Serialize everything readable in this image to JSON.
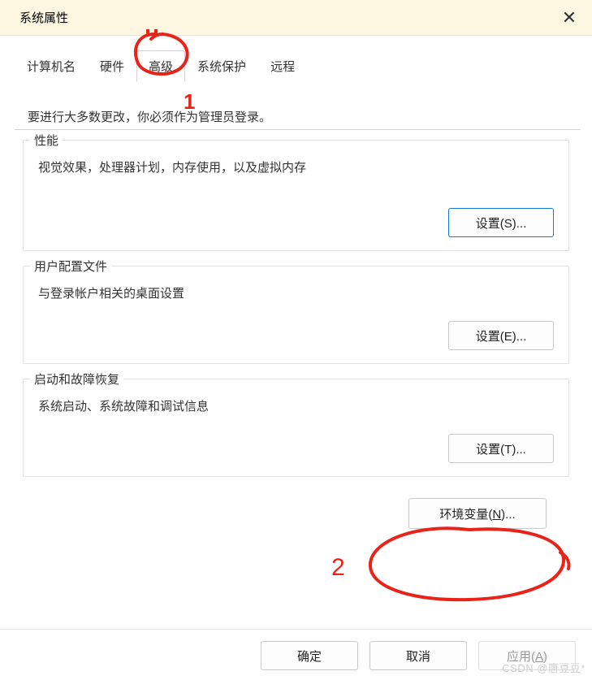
{
  "title": "系统属性",
  "close_icon": "✕",
  "tabs": {
    "computer_name": "计算机名",
    "hardware": "硬件",
    "advanced": "高级",
    "system_protection": "系统保护",
    "remote": "远程"
  },
  "admin_note": "要进行大多数更改，你必须作为管理员登录。",
  "performance": {
    "title": "性能",
    "desc": "视觉效果，处理器计划，内存使用，以及虚拟内存",
    "button": "设置(S)..."
  },
  "user_profiles": {
    "title": "用户配置文件",
    "desc": "与登录帐户相关的桌面设置",
    "button": "设置(E)..."
  },
  "startup_recovery": {
    "title": "启动和故障恢复",
    "desc": "系统启动、系统故障和调试信息",
    "button": "设置(T)..."
  },
  "env_button_prefix": "环境变量(",
  "env_button_under": "N",
  "env_button_suffix": ")...",
  "dialog": {
    "ok": "确定",
    "cancel": "取消",
    "apply_prefix": "应用(",
    "apply_under": "A",
    "apply_suffix": ")"
  },
  "annotations": {
    "num1": "1",
    "num2": "2"
  },
  "watermark": "CSDN @唐豆豆*"
}
